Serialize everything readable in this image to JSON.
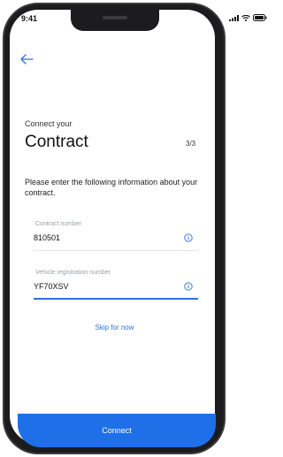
{
  "status_bar": {
    "time": "9:41",
    "icons": [
      "signal-icon",
      "wifi-icon",
      "battery-icon"
    ]
  },
  "nav": {
    "back_icon": "back-arrow-icon"
  },
  "header": {
    "eyebrow": "Connect your",
    "title": "Contract",
    "step": "3/3"
  },
  "instruction": "Please enter the following information about your contract.",
  "fields": [
    {
      "label": "Contract number",
      "value": "810501",
      "icon": "info-icon"
    },
    {
      "label": "Vehicle registration number",
      "value": "YF70XSV",
      "icon": "info-icon"
    }
  ],
  "skip_label": "Skip for now",
  "connect_label": "Connect",
  "colors": {
    "accent": "#2f6fe0",
    "button": "#1e6fe8",
    "phone_frame": "#1c1c1e"
  }
}
